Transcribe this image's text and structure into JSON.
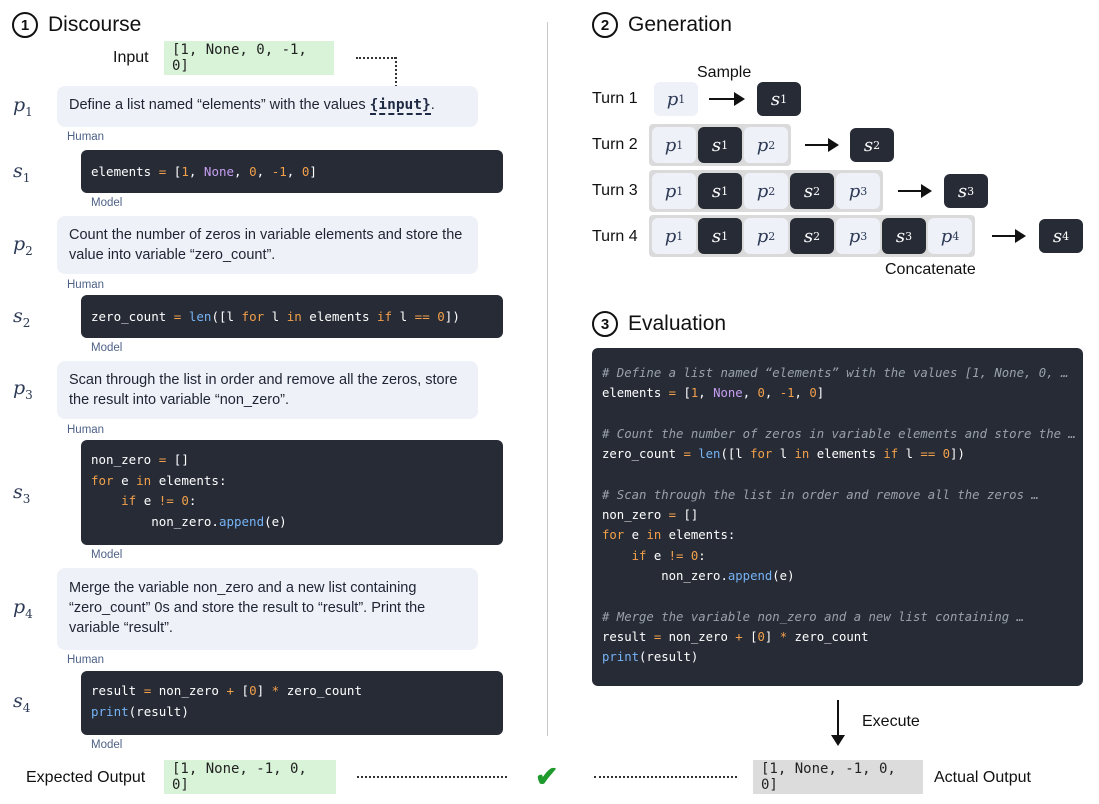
{
  "discourse": {
    "number": "1",
    "title": "Discourse",
    "input_label": "Input",
    "input_value": "[1, None, 0, -1, 0]",
    "role_human": "Human",
    "role_model": "Model",
    "steps": [
      {
        "prompt_var": "p",
        "prompt_sub": "1",
        "prompt_text_before": "Define a list named “elements” with the values ",
        "prompt_inline": "{input}",
        "prompt_text_after": ".",
        "solution_var": "s",
        "solution_sub": "1"
      },
      {
        "prompt_var": "p",
        "prompt_sub": "2",
        "prompt_text": "Count the number of zeros in variable elements and store the value into variable “zero_count”.",
        "solution_var": "s",
        "solution_sub": "2"
      },
      {
        "prompt_var": "p",
        "prompt_sub": "3",
        "prompt_text": "Scan through the list in order and remove all the zeros, store the result into variable “non_zero”.",
        "solution_var": "s",
        "solution_sub": "3"
      },
      {
        "prompt_var": "p",
        "prompt_sub": "4",
        "prompt_text": "Merge the variable non_zero and a new list containing “zero_count” 0s and store the result to “result”. Print the variable “result”.",
        "solution_var": "s",
        "solution_sub": "4"
      }
    ],
    "expected_label": "Expected Output",
    "expected_value": "[1, None, -1, 0, 0]"
  },
  "generation": {
    "number": "2",
    "title": "Generation",
    "sample_label": "Sample",
    "concat_label": "Concatenate",
    "turns": [
      {
        "label": "Turn 1",
        "out_sub": "1"
      },
      {
        "label": "Turn 2",
        "out_sub": "2"
      },
      {
        "label": "Turn 3",
        "out_sub": "3"
      },
      {
        "label": "Turn 4",
        "out_sub": "4"
      }
    ]
  },
  "evaluation": {
    "number": "3",
    "title": "Evaluation",
    "execute_label": "Execute",
    "actual_label": "Actual Output",
    "actual_value": "[1, None, -1, 0, 0]",
    "comments": [
      "# Define a list named “elements” with the values [1, None, 0, …",
      "# Count the number of zeros in variable elements and store the …",
      "# Scan through the list in order and remove all the zeros …",
      "# Merge the variable non_zero and a new list containing …"
    ]
  },
  "colors": {
    "code_bg": "#262b36",
    "human_bg": "#eef1f7",
    "green": "#d8f3d8",
    "check": "#1f9a2c"
  },
  "icons": {
    "match": "checkmark-icon"
  }
}
